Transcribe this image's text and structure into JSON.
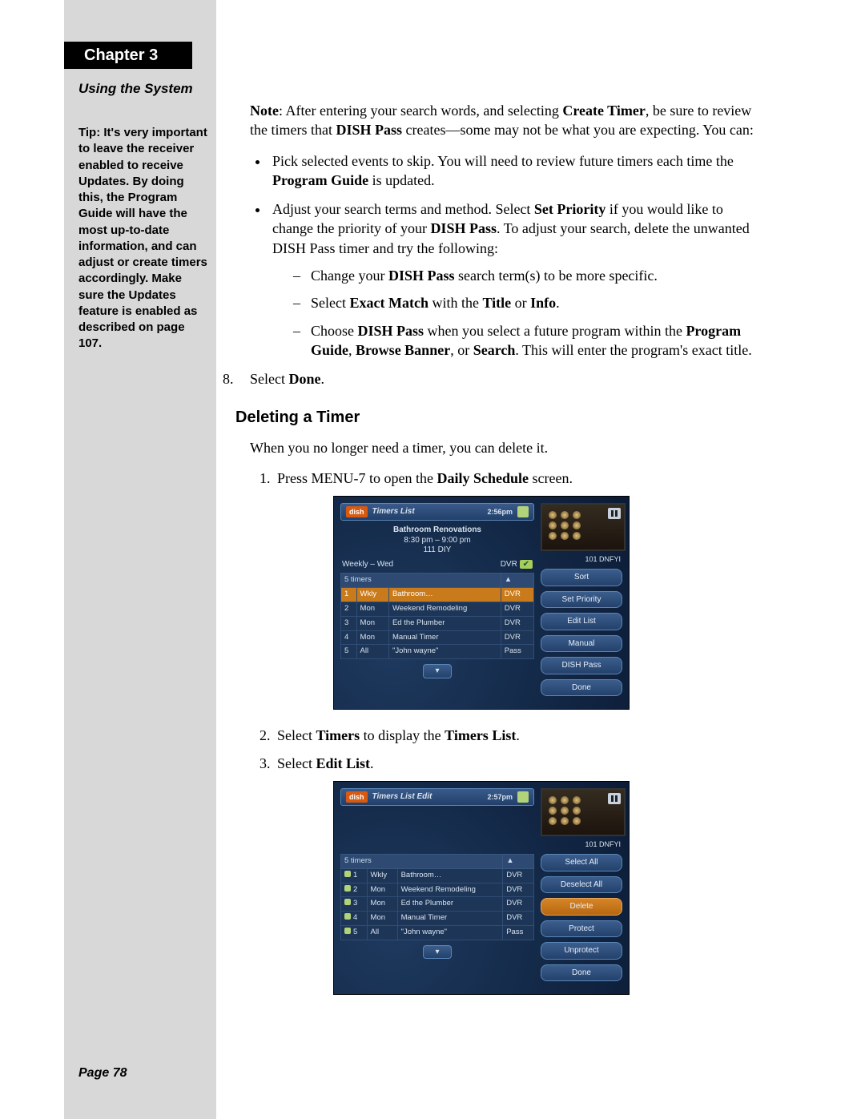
{
  "chapter": "Chapter 3",
  "section": "Using the System",
  "tip": "Tip: It's very important to leave the receiver enabled to receive Updates. By doing this, the Program Guide will have the most up-to-date information, and can adjust or create timers accordingly. Make sure the Updates feature is enabled as described on page 107.",
  "page_number": "Page 78",
  "note_prefix": "Note",
  "note_1a": ": After entering your search words, and selecting ",
  "note_bold_createtimer": "Create Timer",
  "note_1b": ", be sure to review the timers that ",
  "note_bold_dishpass": "DISH Pass",
  "note_1c": " creates—some may not be what you are expecting. You can:",
  "bullet1_a": "Pick selected events to skip. You will need to review future timers each time the ",
  "bullet1_bold_pg": "Program Guide",
  "bullet1_b": " is updated.",
  "bullet2_a": "Adjust your search terms and method. Select ",
  "bullet2_bold_sp": "Set Priority",
  "bullet2_b": " if you would like to change the priority of your ",
  "bullet2_bold_dp": "DISH Pass",
  "bullet2_c": ". To adjust your search, delete the unwanted DISH Pass timer and try the following:",
  "dash1_a": "Change your ",
  "dash1_bold_dp": "DISH Pass",
  "dash1_b": " search term(s) to be more specific.",
  "dash2_a": "Select ",
  "dash2_bold_em": "Exact Match",
  "dash2_b": " with the ",
  "dash2_bold_t": "Title",
  "dash2_c": " or ",
  "dash2_bold_i": "Info",
  "dash2_d": ".",
  "dash3_a": "Choose ",
  "dash3_bold_dp": "DISH Pass",
  "dash3_b": " when you select a future program within the ",
  "dash3_bold_pg": "Program Guide",
  "dash3_c": ", ",
  "dash3_bold_bb": "Browse Banner",
  "dash3_d": ", or ",
  "dash3_bold_s": "Search",
  "dash3_e": ". This will enter the program's exact title.",
  "step8_a": "Select ",
  "step8_bold_done": "Done",
  "step8_b": ".",
  "h3_deleting": "Deleting a Timer",
  "deleting_intro": "When you no longer need a timer, you can delete it.",
  "d_step1_a": "Press MENU-7 to open the ",
  "d_step1_bold": "Daily Schedule",
  "d_step1_b": " screen.",
  "d_step2_a": "Select ",
  "d_step2_bold1": "Timers",
  "d_step2_b": " to display the ",
  "d_step2_bold2": "Timers List",
  "d_step2_c": ".",
  "d_step3_a": "Select ",
  "d_step3_bold": "Edit List",
  "d_step3_b": ".",
  "dvr1": {
    "logo": "dish",
    "title": "Timers List",
    "time": "2:56pm",
    "prog_title": "Bathroom Renovations",
    "prog_time": "8:30 pm – 9:00 pm",
    "prog_ch": "111 DIY",
    "pip_caption": "101 DNFYI",
    "weekly": "Weekly – Wed",
    "dvr_label": "DVR",
    "th_count": "5 timers",
    "th_sort": "▲",
    "rows": [
      {
        "n": "1",
        "freq": "Wkly",
        "name": "Bathroom…",
        "type": "DVR",
        "hl": true
      },
      {
        "n": "2",
        "freq": "Mon",
        "name": "Weekend Remodeling",
        "type": "DVR"
      },
      {
        "n": "3",
        "freq": "Mon",
        "name": "Ed the Plumber",
        "type": "DVR"
      },
      {
        "n": "4",
        "freq": "Mon",
        "name": "Manual Timer",
        "type": "DVR"
      },
      {
        "n": "5",
        "freq": "All",
        "name": "\"John wayne\"",
        "type": "Pass"
      }
    ],
    "btns": [
      "Sort",
      "Set Priority",
      "Edit List",
      "Manual",
      "DISH Pass",
      "Done"
    ]
  },
  "dvr2": {
    "logo": "dish",
    "title": "Timers List Edit",
    "time": "2:57pm",
    "pip_caption": "101 DNFYI",
    "th_count": "5 timers",
    "th_sort": "▲",
    "rows": [
      {
        "n": "1",
        "freq": "Wkly",
        "name": "Bathroom…",
        "type": "DVR"
      },
      {
        "n": "2",
        "freq": "Mon",
        "name": "Weekend Remodeling",
        "type": "DVR"
      },
      {
        "n": "3",
        "freq": "Mon",
        "name": "Ed the Plumber",
        "type": "DVR"
      },
      {
        "n": "4",
        "freq": "Mon",
        "name": "Manual Timer",
        "type": "DVR"
      },
      {
        "n": "5",
        "freq": "All",
        "name": "\"John wayne\"",
        "type": "Pass"
      }
    ],
    "btns_hl_index": 2,
    "btns": [
      "Select All",
      "Deselect All",
      "Delete",
      "Protect",
      "Unprotect",
      "Done"
    ]
  }
}
